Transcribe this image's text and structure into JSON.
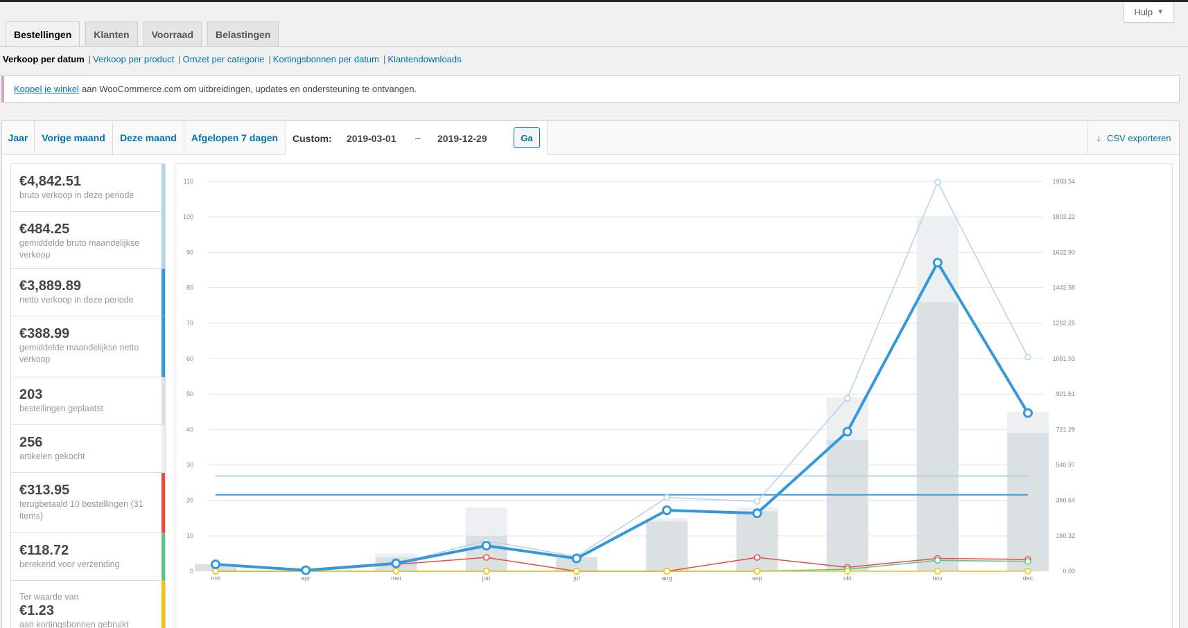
{
  "help": {
    "label": "Hulp"
  },
  "tabs": [
    {
      "label": "Bestellingen",
      "active": true
    },
    {
      "label": "Klanten",
      "active": false
    },
    {
      "label": "Voorraad",
      "active": false
    },
    {
      "label": "Belastingen",
      "active": false
    }
  ],
  "sub_reports": [
    "Verkoop per datum",
    "Verkoop per product",
    "Omzet per categorie",
    "Kortingsbonnen per datum",
    "Klantendownloads"
  ],
  "notice": {
    "link": "Koppel je winkel",
    "text": "aan WooCommerce.com om uitbreidingen, updates en ondersteuning te ontvangen."
  },
  "ranges": [
    "Jaar",
    "Vorige maand",
    "Deze maand",
    "Afgelopen 7 dagen"
  ],
  "custom": {
    "label": "Custom:",
    "start": "2019-03-01",
    "separator": "–",
    "end": "2019-12-29",
    "button": "Ga"
  },
  "export": {
    "label": "CSV exporteren"
  },
  "legend": [
    {
      "value": "€4,842.51",
      "label": "bruto verkoop in deze periode",
      "color": "#b1d4ea"
    },
    {
      "value": "€484.25",
      "label": "gemiddelde bruto maandelijkse verkoop",
      "color": "#b1d4ea"
    },
    {
      "value": "€3,889.89",
      "label": "netto verkoop in deze periode",
      "color": "#3498db"
    },
    {
      "value": "€388.99",
      "label": "gemiddelde maandelijkse netto verkoop",
      "color": "#3498db"
    },
    {
      "value": "203",
      "label": "bestellingen geplaatst",
      "color": "#dbe1e3"
    },
    {
      "value": "256",
      "label": "artikelen gekocht",
      "color": "#ecf0f1"
    },
    {
      "value": "€313.95",
      "label": "terugbetaald 10 bestellingen (31 items)",
      "color": "#e74c3c"
    },
    {
      "value": "€118.72",
      "label": "berekend voor verzending",
      "color": "#5cc488"
    },
    {
      "prefix": "Ter waarde van",
      "value": "€1.23",
      "label": "aan kortingsbonnen gebruikt",
      "color": "#f1c40f"
    }
  ],
  "chart_data": {
    "type": "bar",
    "categories": [
      "mrt",
      "apr",
      "mei",
      "jun",
      "jul",
      "aug",
      "sep",
      "okt",
      "nov",
      "dec"
    ],
    "y_left": {
      "min": 0,
      "max": 110,
      "ticks": [
        0,
        10,
        20,
        30,
        40,
        50,
        60,
        70,
        80,
        90,
        100,
        110
      ]
    },
    "y_right": {
      "min": 0,
      "max": 1983.54,
      "ticks": [
        "0.00",
        "180.32",
        "360.64",
        "540.97",
        "721.29",
        "901.61",
        "1081.93",
        "1262.25",
        "1442.58",
        "1622.90",
        "1803.22",
        "1983.54"
      ]
    },
    "grid": true,
    "bars": [
      {
        "color": "#ecf0f1",
        "axis": "left",
        "values": [
          2,
          0,
          5,
          18,
          4,
          15,
          18,
          49,
          100,
          45
        ]
      },
      {
        "color": "#dbe1e3",
        "axis": "left",
        "values": [
          2,
          0,
          4,
          10,
          4,
          14,
          17,
          37,
          76,
          39
        ]
      }
    ],
    "lines": [
      {
        "color": "#b1d4ea",
        "axis": "right",
        "width": 1.5,
        "marker": true,
        "values": [
          40,
          5,
          40,
          155,
          75,
          375,
          355,
          880,
          1980,
          1090
        ]
      },
      {
        "color": "#3498db",
        "axis": "right",
        "width": 4,
        "marker": true,
        "values": [
          35,
          5,
          40,
          130,
          65,
          310,
          295,
          710,
          1570,
          805
        ]
      },
      {
        "color": "#e74c3c",
        "axis": "right",
        "width": 1.5,
        "marker": true,
        "values": [
          0,
          0,
          35,
          70,
          0,
          0,
          70,
          20,
          65,
          60
        ]
      },
      {
        "color": "#5cc488",
        "axis": "right",
        "width": 1.5,
        "marker": true,
        "values": [
          0,
          0,
          0,
          0,
          0,
          0,
          0,
          10,
          55,
          50
        ]
      },
      {
        "color": "#f1c40f",
        "axis": "right",
        "width": 1.5,
        "marker": true,
        "values": [
          0,
          0,
          0,
          0,
          0,
          0,
          0,
          0,
          0,
          0
        ]
      },
      {
        "color": "#b1d4ea",
        "axis": "right",
        "width": 2,
        "marker": false,
        "average": true,
        "values": [
          484.25,
          484.25,
          484.25,
          484.25,
          484.25,
          484.25,
          484.25,
          484.25,
          484.25,
          484.25
        ]
      },
      {
        "color": "#3498db",
        "axis": "right",
        "width": 2,
        "marker": false,
        "average": true,
        "values": [
          388.99,
          388.99,
          388.99,
          388.99,
          388.99,
          388.99,
          388.99,
          388.99,
          388.99,
          388.99
        ]
      }
    ]
  }
}
